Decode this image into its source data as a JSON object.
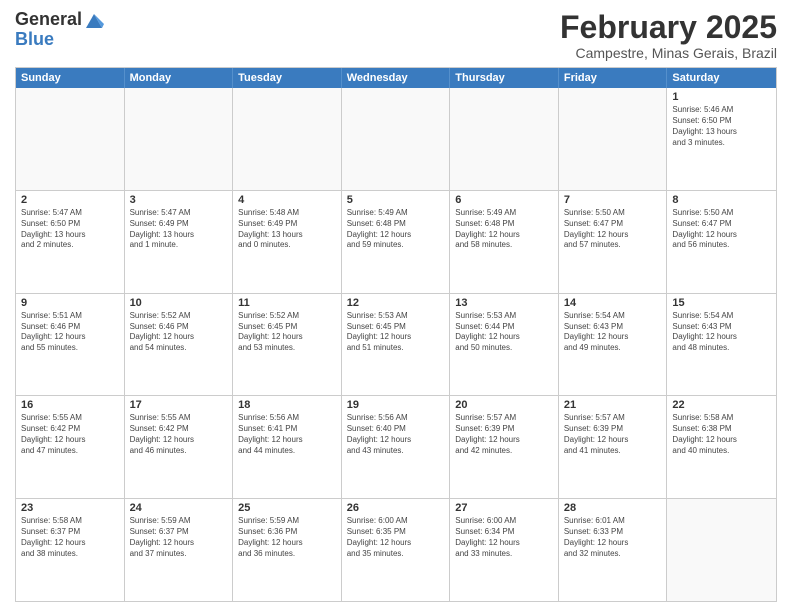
{
  "logo": {
    "general": "General",
    "blue": "Blue"
  },
  "header": {
    "month": "February 2025",
    "location": "Campestre, Minas Gerais, Brazil"
  },
  "weekdays": [
    "Sunday",
    "Monday",
    "Tuesday",
    "Wednesday",
    "Thursday",
    "Friday",
    "Saturday"
  ],
  "weeks": [
    [
      {
        "day": "",
        "info": ""
      },
      {
        "day": "",
        "info": ""
      },
      {
        "day": "",
        "info": ""
      },
      {
        "day": "",
        "info": ""
      },
      {
        "day": "",
        "info": ""
      },
      {
        "day": "",
        "info": ""
      },
      {
        "day": "1",
        "info": "Sunrise: 5:46 AM\nSunset: 6:50 PM\nDaylight: 13 hours\nand 3 minutes."
      }
    ],
    [
      {
        "day": "2",
        "info": "Sunrise: 5:47 AM\nSunset: 6:50 PM\nDaylight: 13 hours\nand 2 minutes."
      },
      {
        "day": "3",
        "info": "Sunrise: 5:47 AM\nSunset: 6:49 PM\nDaylight: 13 hours\nand 1 minute."
      },
      {
        "day": "4",
        "info": "Sunrise: 5:48 AM\nSunset: 6:49 PM\nDaylight: 13 hours\nand 0 minutes."
      },
      {
        "day": "5",
        "info": "Sunrise: 5:49 AM\nSunset: 6:48 PM\nDaylight: 12 hours\nand 59 minutes."
      },
      {
        "day": "6",
        "info": "Sunrise: 5:49 AM\nSunset: 6:48 PM\nDaylight: 12 hours\nand 58 minutes."
      },
      {
        "day": "7",
        "info": "Sunrise: 5:50 AM\nSunset: 6:47 PM\nDaylight: 12 hours\nand 57 minutes."
      },
      {
        "day": "8",
        "info": "Sunrise: 5:50 AM\nSunset: 6:47 PM\nDaylight: 12 hours\nand 56 minutes."
      }
    ],
    [
      {
        "day": "9",
        "info": "Sunrise: 5:51 AM\nSunset: 6:46 PM\nDaylight: 12 hours\nand 55 minutes."
      },
      {
        "day": "10",
        "info": "Sunrise: 5:52 AM\nSunset: 6:46 PM\nDaylight: 12 hours\nand 54 minutes."
      },
      {
        "day": "11",
        "info": "Sunrise: 5:52 AM\nSunset: 6:45 PM\nDaylight: 12 hours\nand 53 minutes."
      },
      {
        "day": "12",
        "info": "Sunrise: 5:53 AM\nSunset: 6:45 PM\nDaylight: 12 hours\nand 51 minutes."
      },
      {
        "day": "13",
        "info": "Sunrise: 5:53 AM\nSunset: 6:44 PM\nDaylight: 12 hours\nand 50 minutes."
      },
      {
        "day": "14",
        "info": "Sunrise: 5:54 AM\nSunset: 6:43 PM\nDaylight: 12 hours\nand 49 minutes."
      },
      {
        "day": "15",
        "info": "Sunrise: 5:54 AM\nSunset: 6:43 PM\nDaylight: 12 hours\nand 48 minutes."
      }
    ],
    [
      {
        "day": "16",
        "info": "Sunrise: 5:55 AM\nSunset: 6:42 PM\nDaylight: 12 hours\nand 47 minutes."
      },
      {
        "day": "17",
        "info": "Sunrise: 5:55 AM\nSunset: 6:42 PM\nDaylight: 12 hours\nand 46 minutes."
      },
      {
        "day": "18",
        "info": "Sunrise: 5:56 AM\nSunset: 6:41 PM\nDaylight: 12 hours\nand 44 minutes."
      },
      {
        "day": "19",
        "info": "Sunrise: 5:56 AM\nSunset: 6:40 PM\nDaylight: 12 hours\nand 43 minutes."
      },
      {
        "day": "20",
        "info": "Sunrise: 5:57 AM\nSunset: 6:39 PM\nDaylight: 12 hours\nand 42 minutes."
      },
      {
        "day": "21",
        "info": "Sunrise: 5:57 AM\nSunset: 6:39 PM\nDaylight: 12 hours\nand 41 minutes."
      },
      {
        "day": "22",
        "info": "Sunrise: 5:58 AM\nSunset: 6:38 PM\nDaylight: 12 hours\nand 40 minutes."
      }
    ],
    [
      {
        "day": "23",
        "info": "Sunrise: 5:58 AM\nSunset: 6:37 PM\nDaylight: 12 hours\nand 38 minutes."
      },
      {
        "day": "24",
        "info": "Sunrise: 5:59 AM\nSunset: 6:37 PM\nDaylight: 12 hours\nand 37 minutes."
      },
      {
        "day": "25",
        "info": "Sunrise: 5:59 AM\nSunset: 6:36 PM\nDaylight: 12 hours\nand 36 minutes."
      },
      {
        "day": "26",
        "info": "Sunrise: 6:00 AM\nSunset: 6:35 PM\nDaylight: 12 hours\nand 35 minutes."
      },
      {
        "day": "27",
        "info": "Sunrise: 6:00 AM\nSunset: 6:34 PM\nDaylight: 12 hours\nand 33 minutes."
      },
      {
        "day": "28",
        "info": "Sunrise: 6:01 AM\nSunset: 6:33 PM\nDaylight: 12 hours\nand 32 minutes."
      },
      {
        "day": "",
        "info": ""
      }
    ]
  ]
}
